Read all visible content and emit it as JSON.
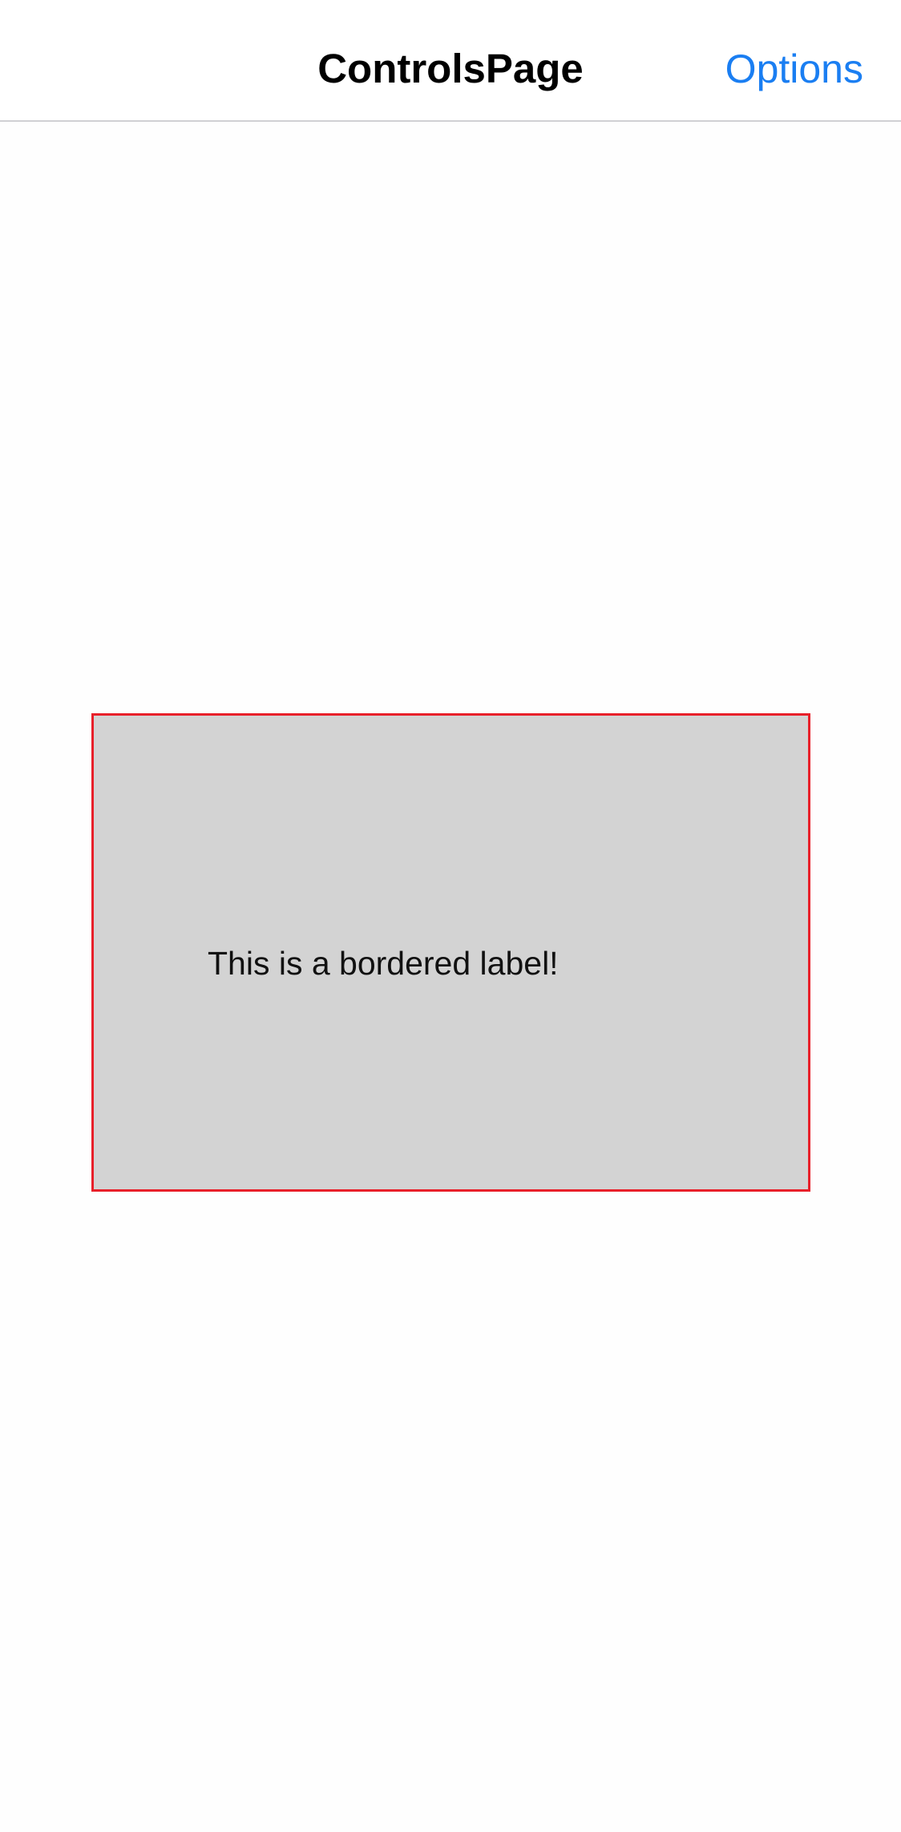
{
  "nav_bar": {
    "title": "ControlsPage",
    "options_label": "Options"
  },
  "content": {
    "bordered_label": "This is a bordered label!"
  },
  "colors": {
    "accent": "#1a7ef2",
    "frame_border": "#e8202a",
    "frame_background": "#d3d3d3"
  }
}
